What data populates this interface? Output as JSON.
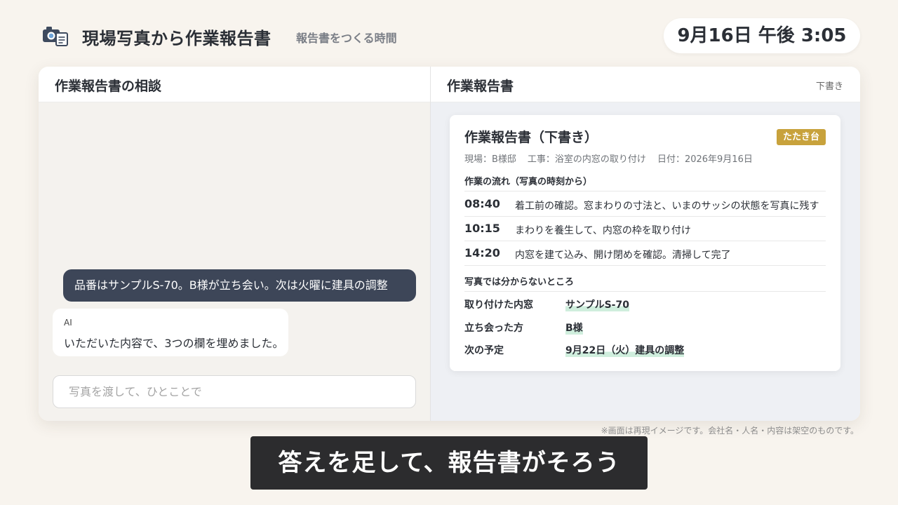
{
  "header": {
    "icon": "camera-document-icon",
    "title": "現場写真から作業報告書",
    "subtitle": "報告書をつくる時間",
    "clock": "9月16日 午後 3:05"
  },
  "chat_panel": {
    "title": "作業報告書の相談",
    "messages": [
      {
        "role": "user",
        "text": "品番はサンプルS-70。B様が立ち会い。次は火曜に建具の調整"
      },
      {
        "role": "assistant",
        "sender": "AI",
        "text": "いただいた内容で、3つの欄を埋めました。"
      }
    ],
    "input": {
      "value": "",
      "placeholder": "写真を渡して、ひとことで"
    }
  },
  "report_panel": {
    "title": "作業報告書",
    "status": "下書き",
    "document": {
      "title": "作業報告書（下書き）",
      "badge": "たたき台",
      "meta": {
        "site": "現場：B様邸",
        "work": "工事：浴室の内窓の取り付け",
        "date": "日付：2026年9月16日"
      },
      "timeline_heading": "作業の流れ（写真の時刻から）",
      "timeline": [
        {
          "time": "08:40",
          "text": "着工前の確認。窓まわりの寸法と、いまのサッシの状態を写真に残す"
        },
        {
          "time": "10:15",
          "text": "まわりを養生して、内窓の枠を取り付け"
        },
        {
          "time": "14:20",
          "text": "内窓を建て込み、開け閉めを確認。清掃して完了"
        }
      ],
      "unknowns_heading": "写真では分からないところ",
      "unknowns": [
        {
          "label": "取り付けた内窓",
          "value": "サンプルS-70"
        },
        {
          "label": "立ち会った方",
          "value": "B様"
        },
        {
          "label": "次の予定",
          "value": "9月22日（火）建具の調整"
        }
      ]
    }
  },
  "disclaimer": "※画面は再現イメージです。会社名・人名・内容は架空のものです。",
  "caption": "答えを足して、報告書がそろう",
  "colors": {
    "page_background": "#f8f4ee",
    "user_bubble": "#3d4658",
    "badge": "#c8a23c",
    "highlight": "#cfeedd",
    "caption_background": "#2c2c2e"
  }
}
